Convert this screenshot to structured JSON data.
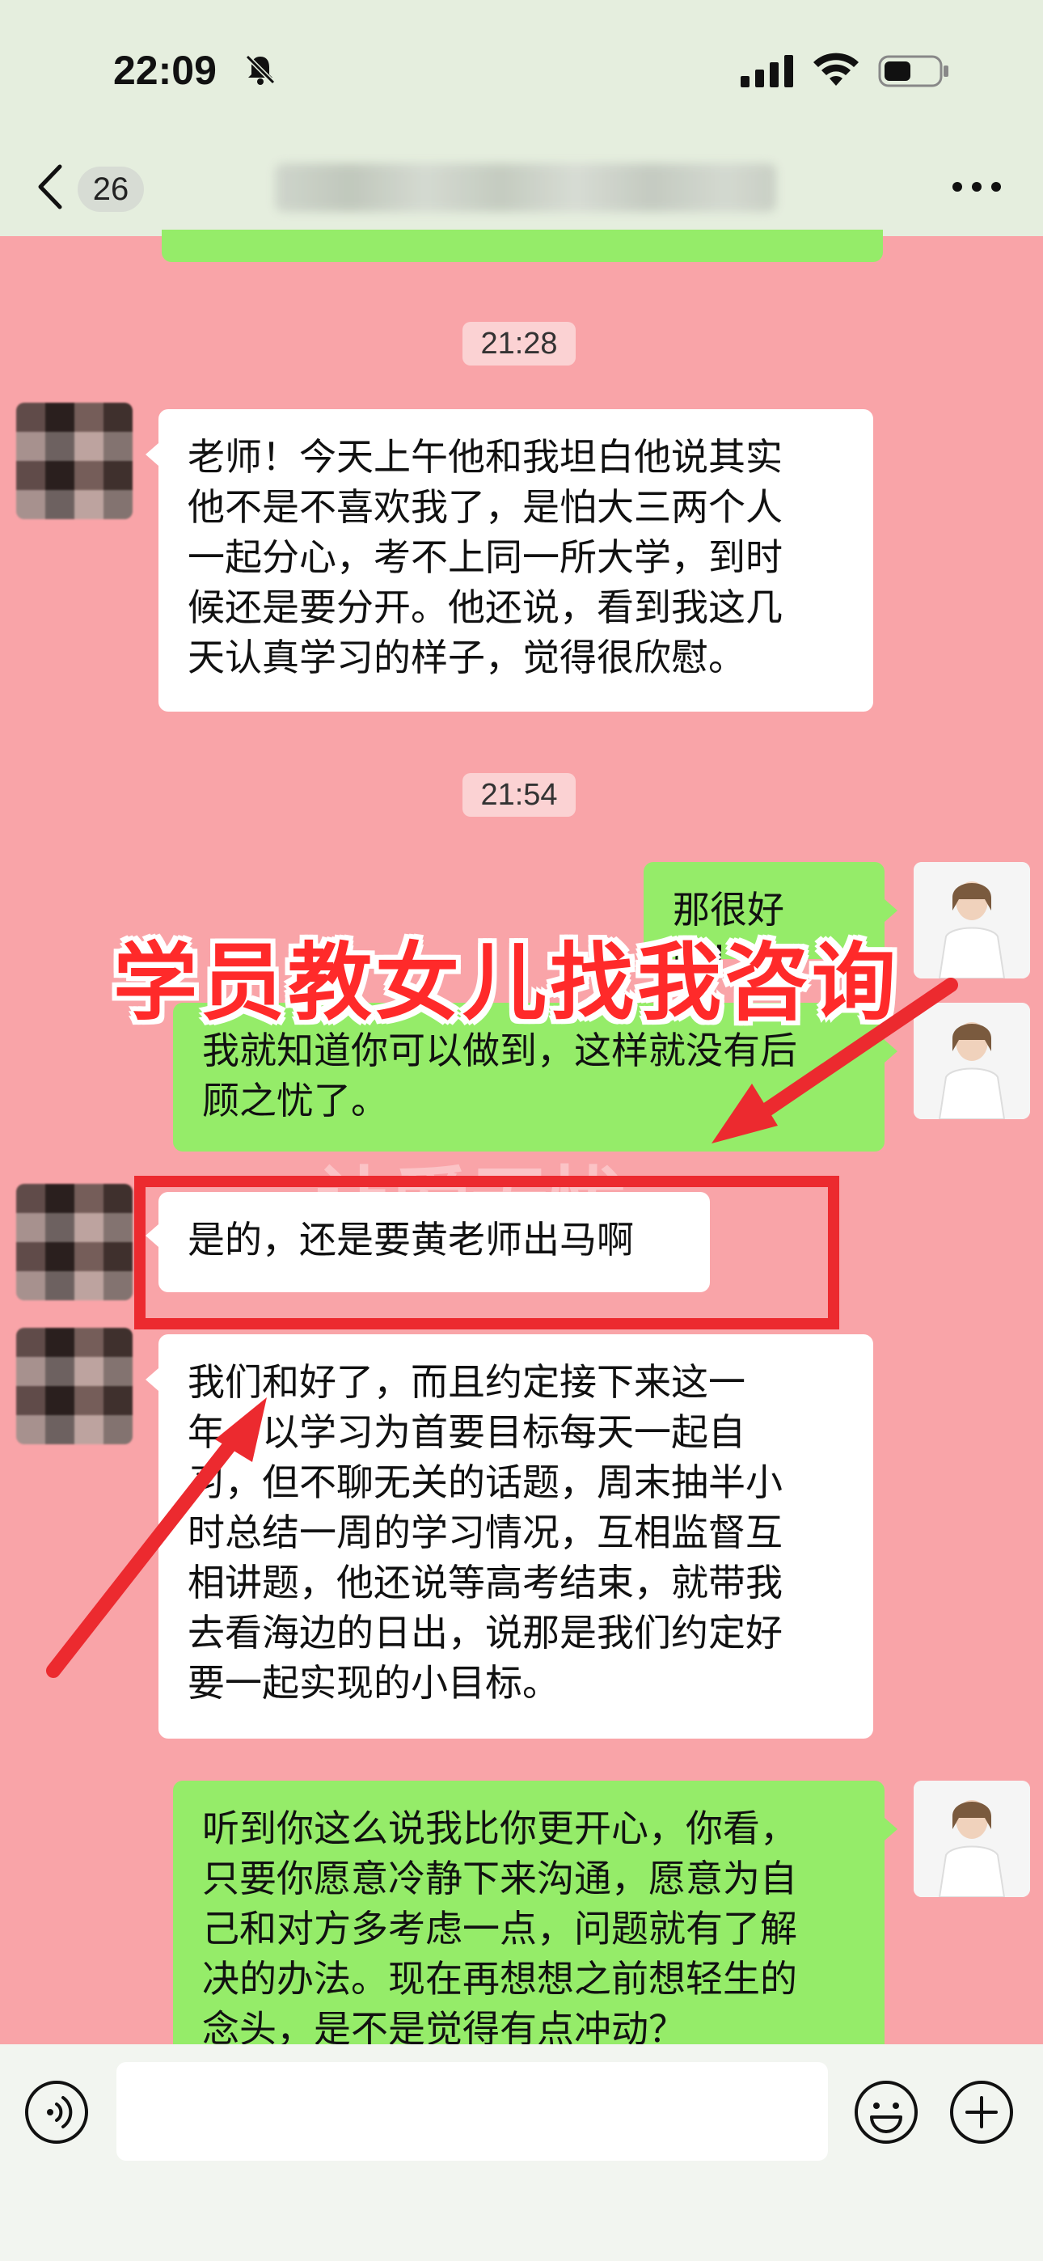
{
  "status_bar": {
    "time": "22:09"
  },
  "nav": {
    "unread_count": "26"
  },
  "messages": {
    "ts1": "21:28",
    "m1": "老师！今天上午他和我坦白他说其实\n他不是不喜欢我了，是怕大三两个人\n一起分心，考不上同一所大学，到时\n候还是要分开。他还说，看到我这几\n天认真学习的样子，觉得很欣慰。",
    "ts2": "21:54",
    "m2": "那很好啊！",
    "m3": "我就知道你可以做到，这样就没有后\n顾之忧了。",
    "m4": "是的，还是要黄老师出马啊",
    "m5": "我们和好了，而且约定接下来这一\n年，以学习为首要目标每天一起自\n习，但不聊无关的话题，周末抽半小\n时总结一周的学习情况，互相监督互\n相讲题，他还说等高考结束，就带我\n去看海边的日出，说那是我们约定好\n要一起实现的小目标。",
    "m6": "听到你这么说我比你更开心，你看，\n只要你愿意冷静下来沟通，愿意为自\n己和对方多考虑一点，问题就有了解\n决的办法。现在再想想之前想轻生的\n念头，是不是觉得有点冲动？"
  },
  "overlay": {
    "caption": "学员教女儿找我咨询",
    "watermark": "让爱无忧"
  },
  "icons": {
    "back": "chevron-left-icon",
    "more": "more-dots-icon",
    "voice": "voice-icon",
    "emoji": "emoji-icon",
    "plus": "plus-icon",
    "mute": "bell-slash-icon",
    "signal": "cellular-signal-icon",
    "wifi": "wifi-icon",
    "battery": "battery-icon"
  },
  "colors": {
    "chat_background": "#f9a4a8",
    "sent_bubble": "#95ec69",
    "received_bubble": "#ffffff",
    "annotation_red": "#ec2a2f"
  }
}
